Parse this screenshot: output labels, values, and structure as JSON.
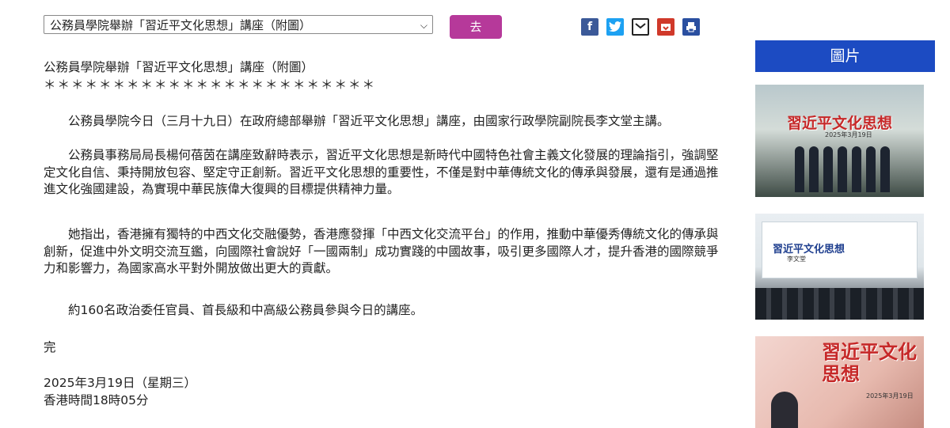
{
  "toolbar": {
    "select_value": "公務員學院舉辦「習近平文化思想」講座（附圖）",
    "go_label": "去",
    "share_icons": [
      "facebook-icon",
      "twitter-icon",
      "email-icon",
      "weibo-icon",
      "print-icon"
    ]
  },
  "article": {
    "title": "公務員學院舉辦「習近平文化思想」講座（附圖）",
    "stars": "＊＊＊＊＊＊＊＊＊＊＊＊＊＊＊＊＊＊＊＊＊＊＊＊",
    "paragraphs": [
      "公務員學院今日（三月十九日）在政府總部舉辦「習近平文化思想」講座，由國家行政學院副院長李文堂主講。",
      "公務員事務局局長楊何蓓茵在講座致辭時表示，習近平文化思想是新時代中國特色社會主義文化發展的理論指引，強調堅定文化自信、秉持開放包容、堅定守正創新。習近平文化思想的重要性，不僅是對中華傳統文化的傳承與發展，還有是通過推進文化強國建設，為實現中華民族偉大復興的目標提供精神力量。",
      "她指出，香港擁有獨特的中西文化交融優勢，香港應發揮「中西文化交流平台」的作用，推動中華優秀傳統文化的傳承與創新，促進中外文明交流互鑑，向國際社會說好「一國兩制」成功實踐的中國故事，吸引更多國際人才，提升香港的國際競爭力和影響力，為國家高水平對外開放做出更大的貢獻。",
      "約160名政治委任官員、首長級和中高級公務員參與今日的講座。"
    ],
    "end_mark": "完",
    "date": "2025年3月19日（星期三）",
    "time": "香港時間18時05分"
  },
  "sidebar": {
    "heading": "圖片",
    "photos": [
      {
        "title": "習近平文化思想",
        "date": "2025年3月19日"
      },
      {
        "title": "習近平文化思想",
        "speaker": "李文堂"
      },
      {
        "title": "習近平文化思想",
        "date": "2025年3月19日"
      }
    ]
  }
}
